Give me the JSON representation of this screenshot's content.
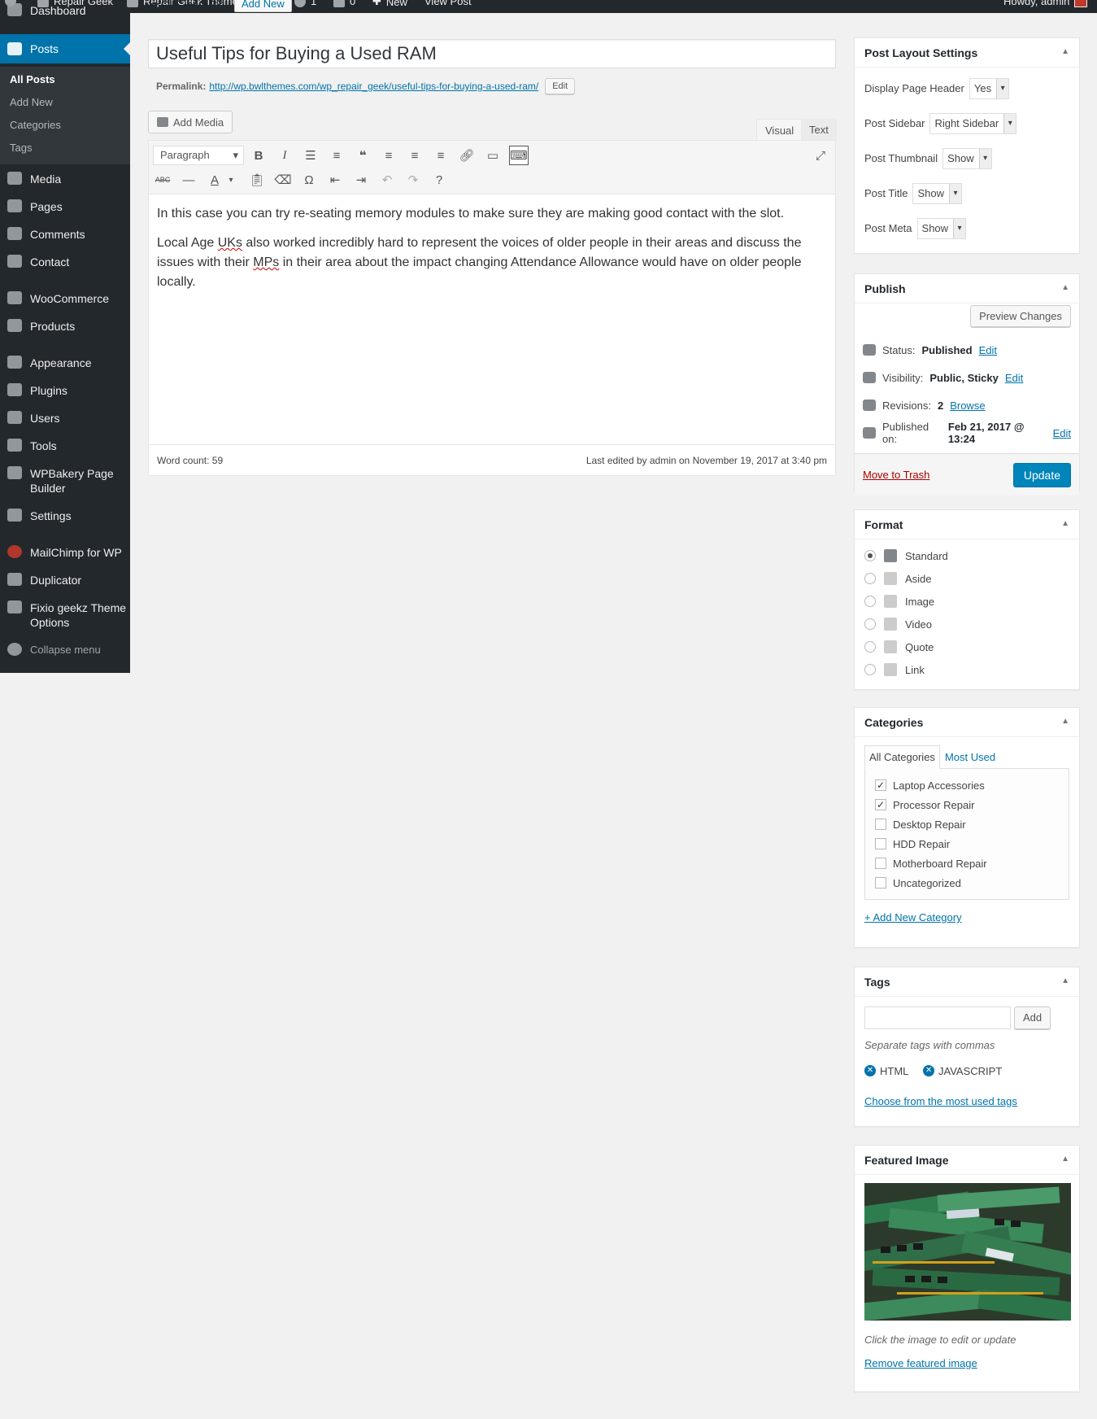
{
  "admin_bar": {
    "site_name": "Repair Geek",
    "theme_options": "Repair Geek Theme Options",
    "updates_count": "1",
    "comments_count": "0",
    "new_label": "New",
    "view_post": "View Post",
    "greeting": "Howdy, admin"
  },
  "sidebar": {
    "dashboard": "Dashboard",
    "posts": "Posts",
    "submenu": [
      "All Posts",
      "Add New",
      "Categories",
      "Tags"
    ],
    "media": "Media",
    "pages": "Pages",
    "comments": "Comments",
    "contact": "Contact",
    "woocommerce": "WooCommerce",
    "products": "Products",
    "appearance": "Appearance",
    "plugins": "Plugins",
    "users": "Users",
    "tools": "Tools",
    "wpbakery_1": "WPBakery Page",
    "wpbakery_2": "Builder",
    "settings": "Settings",
    "mailchimp": "MailChimp for WP",
    "duplicator": "Duplicator",
    "fixio_1": "Fixio geekz Theme",
    "fixio_2": "Options",
    "collapse": "Collapse menu"
  },
  "page": {
    "heading": "Edit Post",
    "add_new": "Add New",
    "post_title": "Useful Tips for Buying a Used RAM",
    "permalink_label": "Permalink:",
    "permalink_url": "http://wp.bwlthemes.com/wp_repair_geek/useful-tips-for-buying-a-used-ram/",
    "permalink_edit": "Edit"
  },
  "editor": {
    "add_media": "Add Media",
    "tab_visual": "Visual",
    "tab_text": "Text",
    "format": "Paragraph",
    "para1": "In this case you can try re-seating memory modules to make sure they are making good contact with the slot.",
    "para2_a": "Local Age ",
    "para2_uks": "UKs",
    "para2_b": " also worked incredibly hard to represent the voices of older people in their areas and discuss the issues with their ",
    "para2_mps": "MPs",
    "para2_c": " in their area about the impact changing Attendance Allowance would have on older people locally.",
    "word_count": "Word count: 59",
    "last_edited": "Last edited by admin on November 19, 2017 at 3:40 pm"
  },
  "post_layout": {
    "title": "Post Layout Settings",
    "display_header_label": "Display Page Header",
    "display_header_value": "Yes",
    "sidebar_label": "Post Sidebar",
    "sidebar_value": "Right Sidebar",
    "thumbnail_label": "Post Thumbnail",
    "thumbnail_value": "Show",
    "title_label": "Post Title",
    "title_value": "Show",
    "meta_label": "Post Meta",
    "meta_value": "Show"
  },
  "publish": {
    "title": "Publish",
    "preview": "Preview Changes",
    "status_label": "Status:",
    "status_value": "Published",
    "visibility_label": "Visibility:",
    "visibility_value": "Public, Sticky",
    "revisions_label": "Revisions:",
    "revisions_value": "2",
    "browse": "Browse",
    "published_label": "Published on:",
    "published_value": "Feb 21, 2017 @ 13:24",
    "edit": "Edit",
    "trash": "Move to Trash",
    "update": "Update"
  },
  "format": {
    "title": "Format",
    "options": [
      "Standard",
      "Aside",
      "Image",
      "Video",
      "Quote",
      "Link"
    ],
    "selected": "Standard"
  },
  "categories": {
    "title": "Categories",
    "tab_all": "All Categories",
    "tab_most": "Most Used",
    "items": [
      {
        "label": "Laptop Accessories",
        "checked": true
      },
      {
        "label": "Processor Repair",
        "checked": true
      },
      {
        "label": "Desktop Repair",
        "checked": false
      },
      {
        "label": "HDD Repair",
        "checked": false
      },
      {
        "label": "Motherboard Repair",
        "checked": false
      },
      {
        "label": "Uncategorized",
        "checked": false
      }
    ],
    "add_new": "+ Add New Category"
  },
  "tags": {
    "title": "Tags",
    "input_value": "",
    "add_button": "Add",
    "hint": "Separate tags with commas",
    "chips": [
      "HTML",
      "JAVASCRIPT"
    ],
    "choose": "Choose from the most used tags"
  },
  "featured": {
    "title": "Featured Image",
    "hint": "Click the image to edit or update",
    "remove": "Remove featured image"
  },
  "colors": {
    "admin_dark": "#23282d",
    "accent_blue": "#0073aa",
    "update_blue": "#0085ba",
    "trash_red": "#a00"
  }
}
